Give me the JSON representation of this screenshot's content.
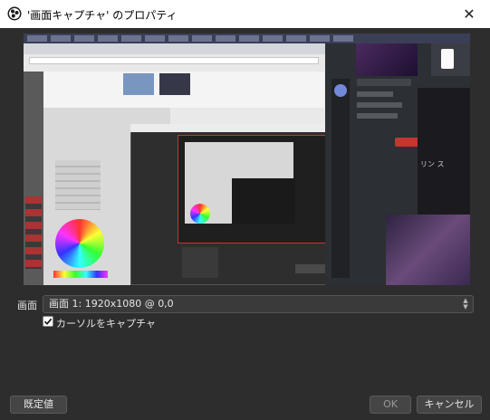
{
  "window": {
    "title": "'画面キャプチャ' のプロパティ",
    "close_label": "✕"
  },
  "properties": {
    "display_label": "画面",
    "display_value": "画面 1: 1920x1080 @ 0,0",
    "capture_cursor_label": "カーソルをキャプチャ",
    "capture_cursor_checked": true
  },
  "buttons": {
    "defaults_label": "既定値",
    "ok_label": "OK",
    "cancel_label": "キャンセル"
  },
  "preview": {
    "side_text": "リン ス"
  },
  "colors": {
    "ok_disabled_text": "#9a9a9a",
    "accent_red": "#c8342f"
  }
}
